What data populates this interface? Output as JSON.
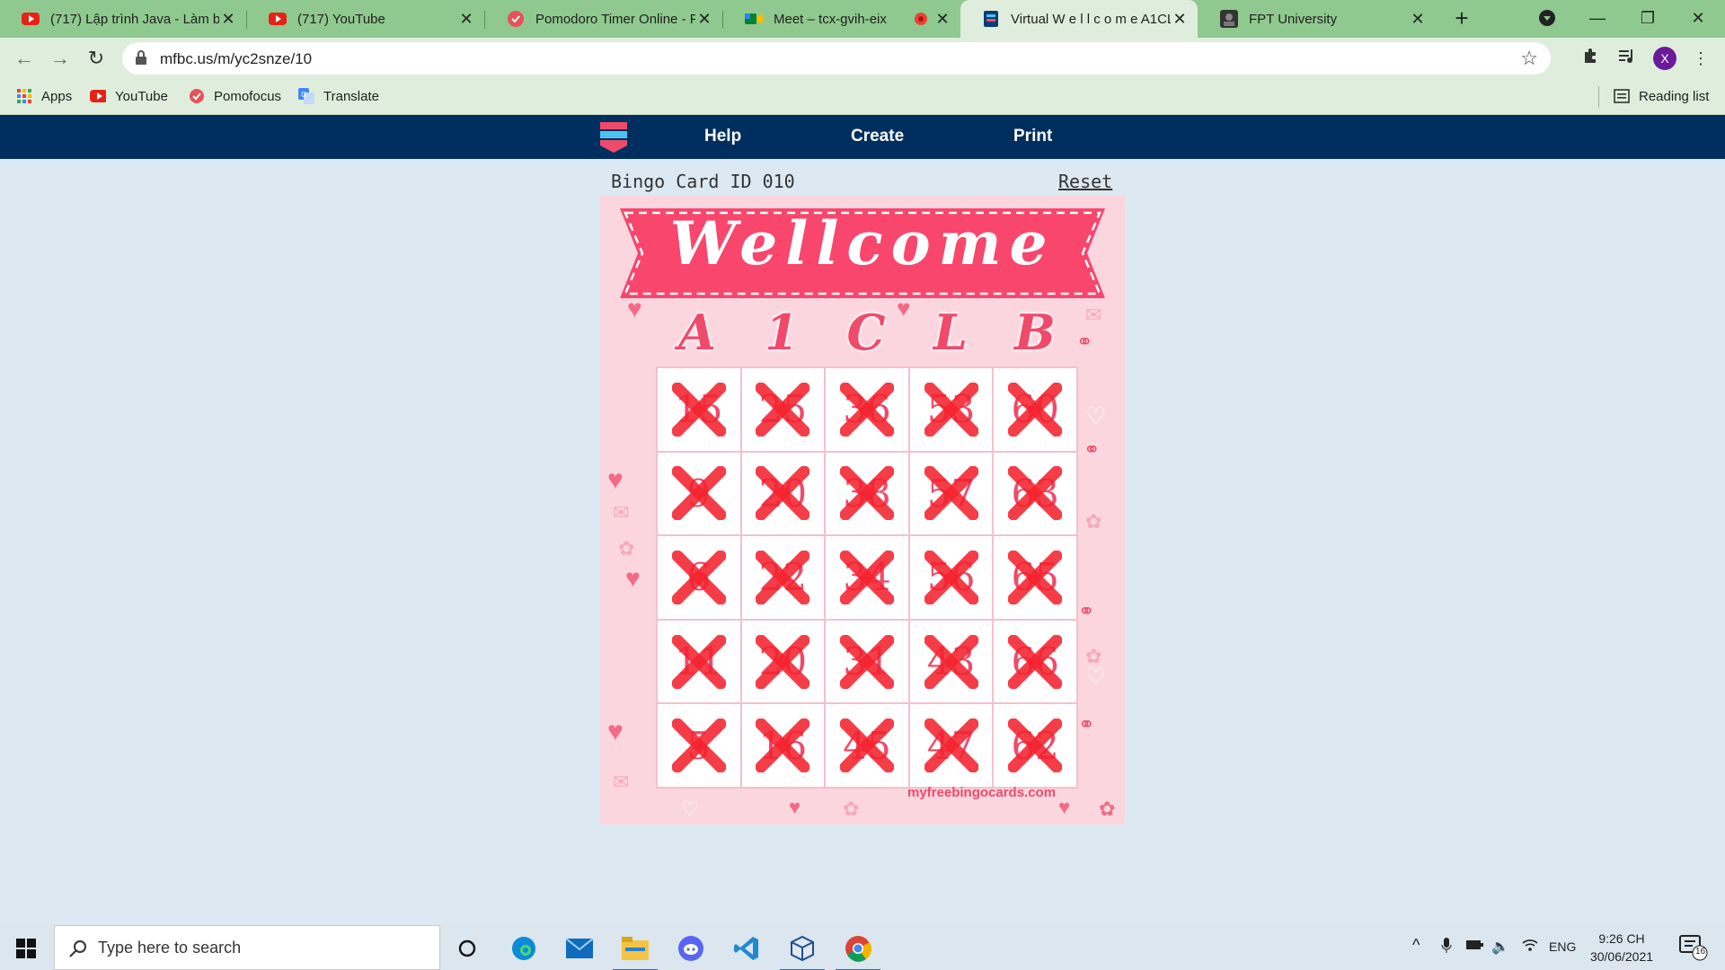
{
  "browser": {
    "tabs": [
      {
        "title": "(717) Lập trình Java - Làm b",
        "icon": "youtube-icon"
      },
      {
        "title": "(717) YouTube",
        "icon": "youtube-icon"
      },
      {
        "title": "Pomodoro Timer Online - Po",
        "icon": "pomofocus-icon"
      },
      {
        "title": "Meet – tcx-gvih-eix",
        "icon": "meet-icon"
      },
      {
        "title": "Virtual W e l l c o m e A1CL",
        "icon": "bingo-icon"
      },
      {
        "title": "FPT University",
        "icon": "fpt-icon"
      }
    ],
    "url": "mfbc.us/m/yc2snze/10",
    "profile_initial": "X",
    "bookmarks": [
      {
        "label": "Apps",
        "icon": "apps-grid-icon"
      },
      {
        "label": "YouTube",
        "icon": "youtube-icon"
      },
      {
        "label": "Pomofocus",
        "icon": "pomofocus-icon"
      },
      {
        "label": "Translate",
        "icon": "translate-icon"
      }
    ],
    "reading_list": "Reading list"
  },
  "site": {
    "nav": [
      "Help",
      "Create",
      "Print"
    ],
    "card_id": "Bingo Card ID 010",
    "reset": "Reset"
  },
  "card": {
    "banner": "Wellcome",
    "letters": [
      "A",
      "1",
      "C",
      "L",
      "B"
    ],
    "numbers": [
      [
        "15",
        "25",
        "36",
        "53",
        "60"
      ],
      [
        "9",
        "20",
        "38",
        "57",
        "63"
      ],
      [
        "6",
        "22",
        "34",
        "56",
        "65"
      ],
      [
        "11",
        "20",
        "31",
        "43",
        "66"
      ],
      [
        "5",
        "16",
        "45",
        "47",
        "62"
      ]
    ],
    "marked": [
      [
        true,
        true,
        true,
        true,
        true
      ],
      [
        true,
        true,
        true,
        true,
        true
      ],
      [
        true,
        true,
        true,
        true,
        true
      ],
      [
        true,
        true,
        true,
        true,
        true
      ],
      [
        true,
        true,
        true,
        true,
        true
      ]
    ],
    "watermark": "myfreebingocards.com",
    "colors": {
      "banner": "#f8466c",
      "mark": "#f4232f",
      "card_bg": "#fbd6df"
    }
  },
  "taskbar": {
    "search_placeholder": "Type here to search",
    "apps": [
      "cortana-icon",
      "edge-icon",
      "mail-icon",
      "file-explorer-icon",
      "discord-icon",
      "vscode-icon",
      "virtualbox-icon",
      "chrome-icon"
    ],
    "language": "ENG",
    "time": "9:26 CH",
    "date": "30/06/2021",
    "notifications": "16"
  }
}
